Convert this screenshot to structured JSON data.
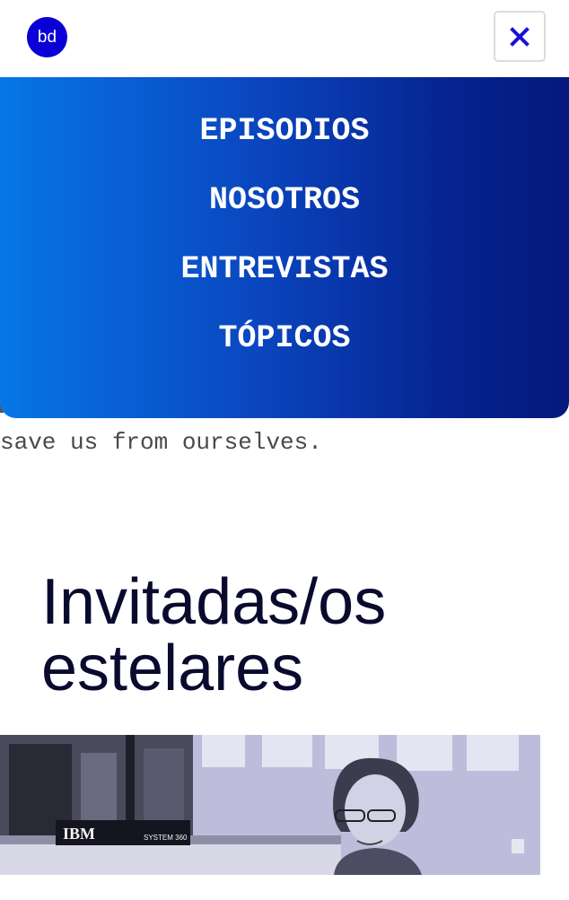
{
  "header": {
    "logo_text": "bd",
    "close_icon": "close-x-icon"
  },
  "menu": {
    "items": [
      {
        "label": "EPISODIOS"
      },
      {
        "label": "NOSOTROS"
      },
      {
        "label": "ENTREVISTAS"
      },
      {
        "label": "TÓPICOS"
      }
    ]
  },
  "content": {
    "partial_text": "save us from ourselves.",
    "section_title_line1": "Invitadas/os",
    "section_title_line2": "estelares",
    "image_sign_text": "IBM",
    "image_machine_text": "SYSTEM 360"
  },
  "colors": {
    "accent": "#0a00d6",
    "menu_gradient_start": "#0677e6",
    "menu_gradient_end": "#041a7c",
    "title_text": "#090a2e"
  }
}
